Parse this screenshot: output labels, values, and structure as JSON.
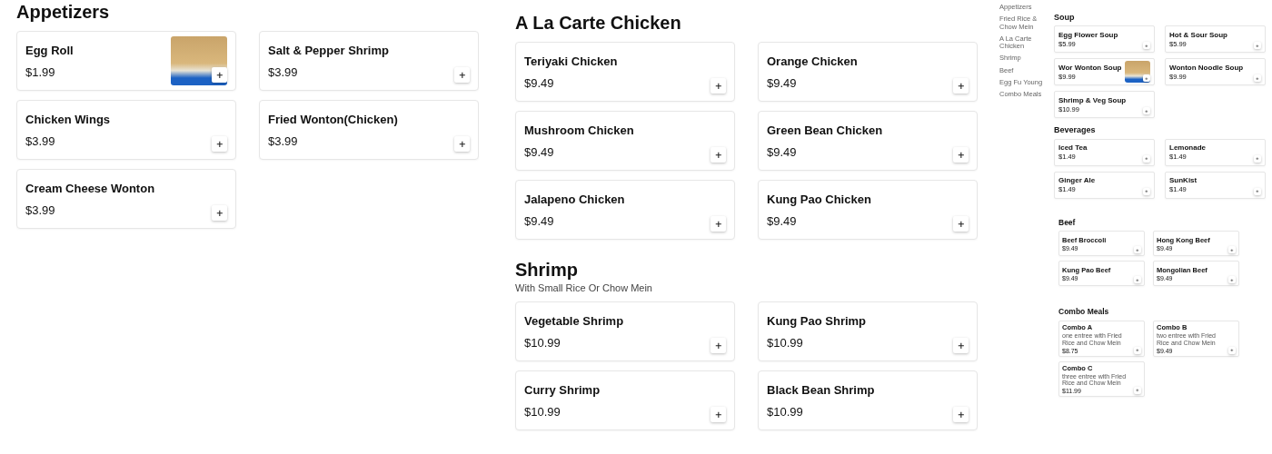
{
  "main_columns": [
    {
      "sections": [
        {
          "title": "Appetizers",
          "items": [
            {
              "name": "Egg Roll",
              "price": "$1.99",
              "has_photo": true
            },
            {
              "name": "Salt & Pepper Shrimp",
              "price": "$3.99",
              "has_photo": false
            },
            {
              "name": "Chicken Wings",
              "price": "$3.99",
              "has_photo": false
            },
            {
              "name": "Fried Wonton(Chicken)",
              "price": "$3.99",
              "has_photo": false
            },
            {
              "name": "Cream Cheese Wonton",
              "price": "$3.99",
              "has_photo": false
            }
          ]
        }
      ]
    },
    {
      "sections": [
        {
          "title": "A La Carte Chicken",
          "items": [
            {
              "name": "Teriyaki Chicken",
              "price": "$9.49",
              "has_photo": false
            },
            {
              "name": "Orange Chicken",
              "price": "$9.49",
              "has_photo": false
            },
            {
              "name": "Mushroom Chicken",
              "price": "$9.49",
              "has_photo": false
            },
            {
              "name": "Green Bean Chicken",
              "price": "$9.49",
              "has_photo": false
            },
            {
              "name": "Jalapeno Chicken",
              "price": "$9.49",
              "has_photo": false
            },
            {
              "name": "Kung Pao Chicken",
              "price": "$9.49",
              "has_photo": false
            }
          ]
        },
        {
          "title": "Shrimp",
          "subtitle": "With Small Rice Or Chow Mein",
          "items": [
            {
              "name": "Vegetable Shrimp",
              "price": "$10.99",
              "has_photo": false
            },
            {
              "name": "Kung Pao Shrimp",
              "price": "$10.99",
              "has_photo": false
            },
            {
              "name": "Curry Shrimp",
              "price": "$10.99",
              "has_photo": false
            },
            {
              "name": "Black Bean Shrimp",
              "price": "$10.99",
              "has_photo": false
            }
          ]
        }
      ]
    }
  ],
  "embedded_page": {
    "sidebar": {
      "items": [
        "Appetizers",
        "Fried Rice & Chow Mein",
        "A La Carte Chicken",
        "Shrimp",
        "Beef",
        "Egg Fu Young",
        "Combo Meals"
      ]
    },
    "sections": [
      {
        "title": "Soup",
        "items": [
          {
            "name": "Egg Flower Soup",
            "price": "$5.99",
            "has_photo": false
          },
          {
            "name": "Hot & Sour Soup",
            "price": "$5.99",
            "has_photo": false
          },
          {
            "name": "Wor Wonton Soup",
            "price": "$9.99",
            "has_photo": true
          },
          {
            "name": "Wonton Noodle Soup",
            "price": "$9.99",
            "has_photo": false
          },
          {
            "name": "Shrimp & Veg Soup",
            "price": "$10.99",
            "has_photo": false
          }
        ]
      },
      {
        "title": "Beverages",
        "items": [
          {
            "name": "Iced Tea",
            "price": "$1.49",
            "has_photo": false
          },
          {
            "name": "Lemonade",
            "price": "$1.49",
            "has_photo": false
          },
          {
            "name": "Ginger Ale",
            "price": "$1.49",
            "has_photo": false
          },
          {
            "name": "SunKist",
            "price": "$1.49",
            "has_photo": false
          }
        ]
      }
    ]
  },
  "embedded_panel": {
    "sections": [
      {
        "title": "Beef",
        "items": [
          {
            "name": "Beef Broccoli",
            "price": "$9.49",
            "has_photo": false
          },
          {
            "name": "Hong Kong Beef",
            "price": "$9.49",
            "has_photo": false
          },
          {
            "name": "Kung Pao Beef",
            "price": "$9.49",
            "has_photo": false
          },
          {
            "name": "Mongolian Beef",
            "price": "$9.49",
            "has_photo": false
          }
        ]
      },
      {
        "title": "Combo Meals",
        "items": [
          {
            "name": "Combo A",
            "description": "one entree with Fried Rice and Chow Mein",
            "price": "$8.75",
            "has_photo": false
          },
          {
            "name": "Combo B",
            "description": "two entree with Fried Rice and Chow Mein",
            "price": "$9.49",
            "has_photo": false
          },
          {
            "name": "Combo C",
            "description": "three entree with Fried Rice and Chow Mein",
            "price": "$11.99",
            "has_photo": false
          }
        ]
      }
    ]
  }
}
